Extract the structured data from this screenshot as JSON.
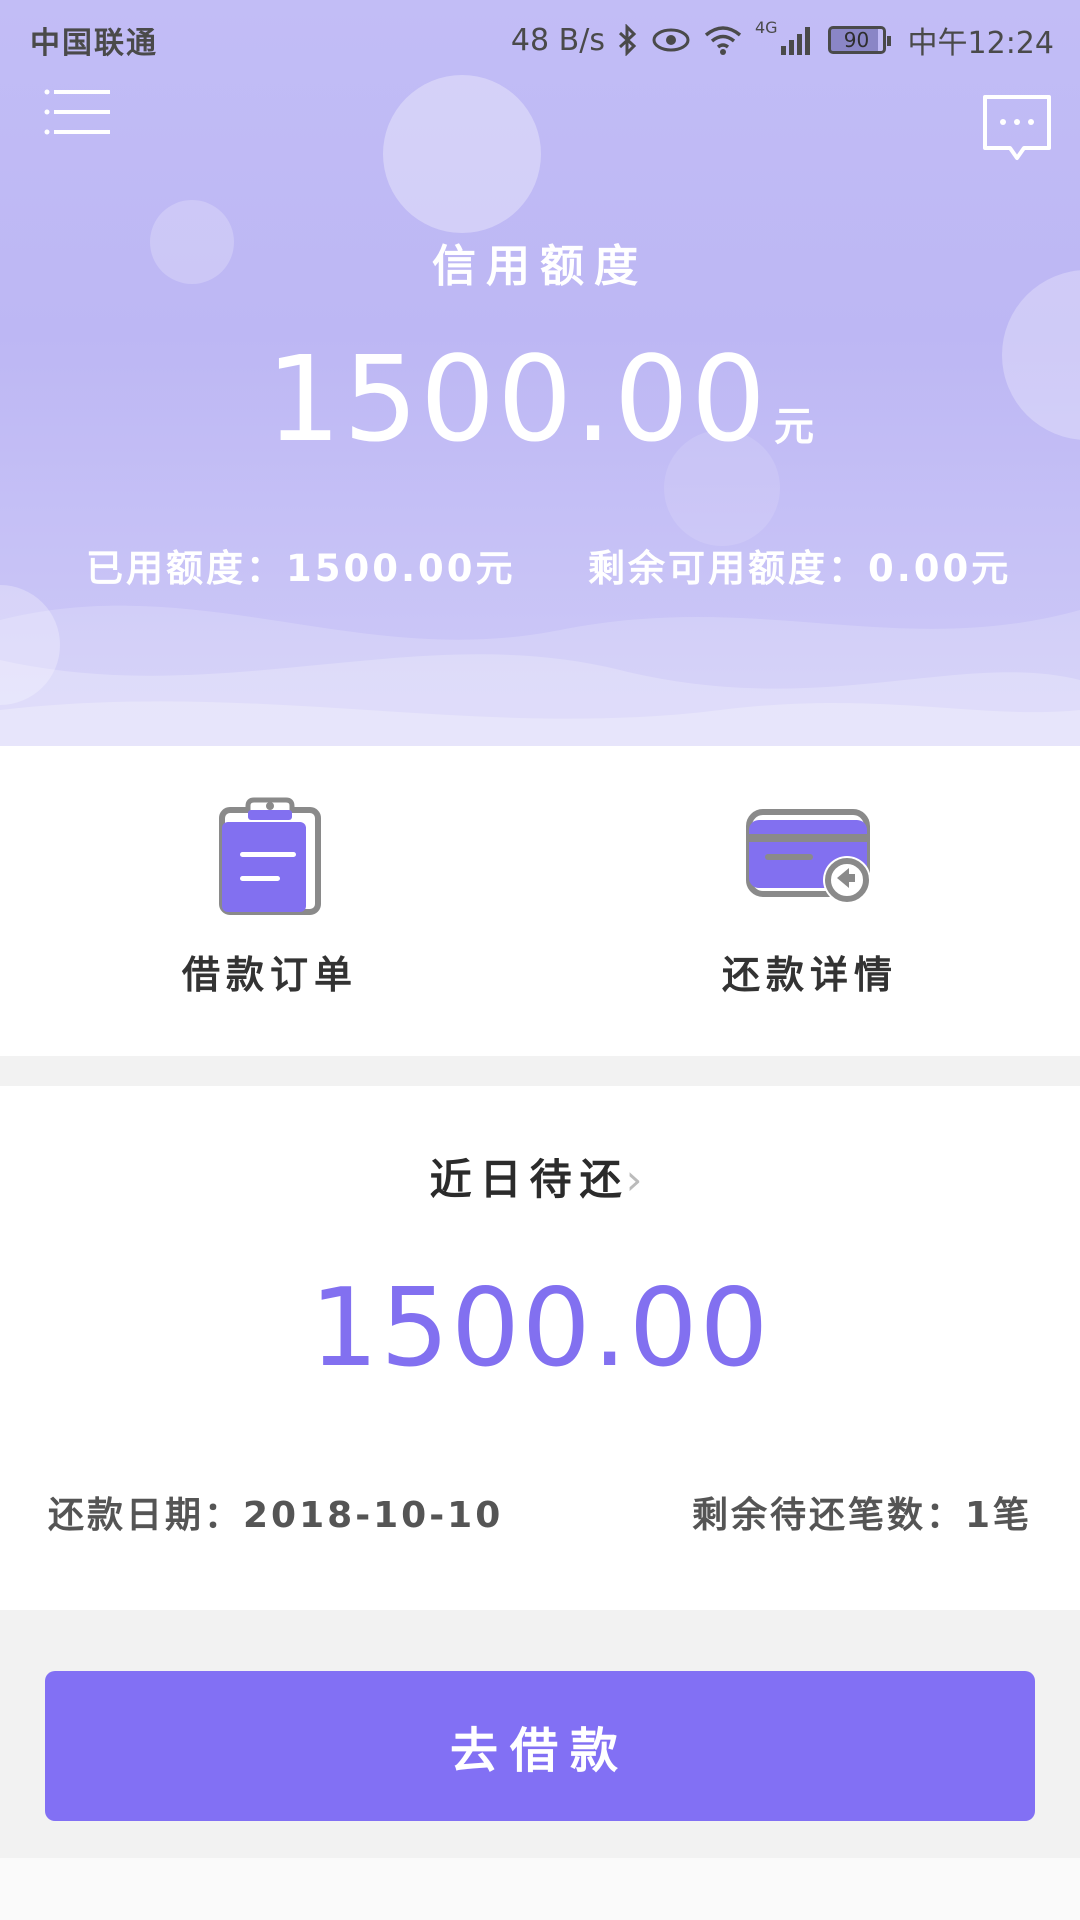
{
  "status_bar": {
    "carrier": "中国联通",
    "net_speed": "48 B/s",
    "network": "4G",
    "battery": "90",
    "time": "中午12:24"
  },
  "header": {
    "menu_icon": "menu-icon",
    "message_icon": "message-icon",
    "title": "信用额度",
    "credit_amount": "1500.00",
    "credit_unit": "元",
    "used_limit": "已用额度：1500.00元",
    "remaining_limit": "剩余可用额度：0.00元"
  },
  "actions": {
    "borrow_orders": {
      "label": "借款订单",
      "icon": "clipboard-icon"
    },
    "repay_details": {
      "label": "还款详情",
      "icon": "card-return-icon"
    }
  },
  "recent": {
    "title": "近日待还",
    "amount": "1500.00",
    "due_date": "还款日期：2018-10-10",
    "remaining_count": "剩余待还笔数：1笔"
  },
  "cta": {
    "label": "去借款"
  },
  "colors": {
    "accent": "#8270f4",
    "header_bg": "#c2bdf6",
    "icon_fill": "#8270f0",
    "icon_stroke": "#8a8a8a"
  }
}
